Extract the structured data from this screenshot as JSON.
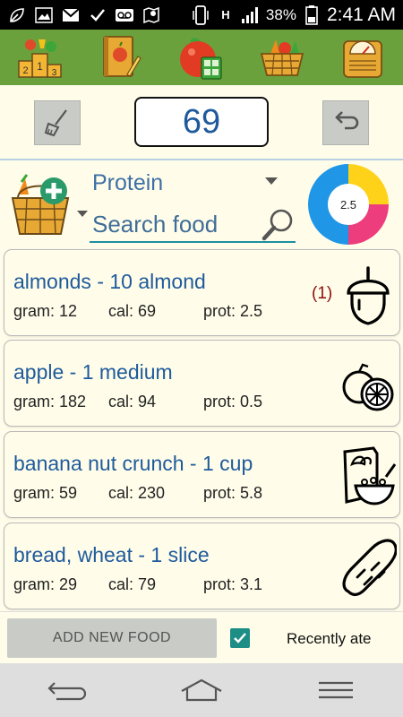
{
  "status_bar": {
    "battery_percent": "38%",
    "time": "2:41 AM",
    "network_label": "H",
    "icons": [
      "leaf-icon",
      "image-icon",
      "gmail-icon",
      "check-icon",
      "voicemail-icon",
      "map-icon",
      "phone-vibrate-icon",
      "signal-icon",
      "battery-icon"
    ]
  },
  "toolbar": {
    "buttons": [
      "podium-icon",
      "notebook-icon",
      "apple-calculator-icon",
      "veggie-basket-icon",
      "scale-icon"
    ]
  },
  "counter": {
    "value": "69"
  },
  "filter": {
    "category": "Protein",
    "search_placeholder": "Search food",
    "donut": {
      "center_label": "2.5",
      "segments": [
        {
          "color": "#ffd21a",
          "value": 0.25
        },
        {
          "color": "#ee3d7d",
          "value": 0.25
        },
        {
          "color": "#1f96e6",
          "value": 0.5
        }
      ]
    }
  },
  "foods": [
    {
      "name": "almonds - 10 almond",
      "gram": "gram: 12",
      "cal": "cal: 69",
      "prot": "prot: 2.5",
      "count": "(1)",
      "icon": "acorn-icon"
    },
    {
      "name": "apple - 1 medium",
      "gram": "gram: 182",
      "cal": "cal: 94",
      "prot": "prot: 0.5",
      "count": "",
      "icon": "citrus-icon"
    },
    {
      "name": "banana nut crunch - 1 cup",
      "gram": "gram: 59",
      "cal": "cal: 230",
      "prot": "prot: 5.8",
      "count": "",
      "icon": "cereal-icon"
    },
    {
      "name": "bread, wheat - 1 slice",
      "gram": "gram: 29",
      "cal": "cal: 79",
      "prot": "prot: 3.1",
      "count": "",
      "icon": "bread-icon"
    }
  ],
  "bottom": {
    "add_label": "ADD NEW FOOD",
    "recent_checked": true,
    "recent_label": "Recently ate"
  },
  "nav": [
    "back-icon",
    "home-icon",
    "menu-icon"
  ]
}
